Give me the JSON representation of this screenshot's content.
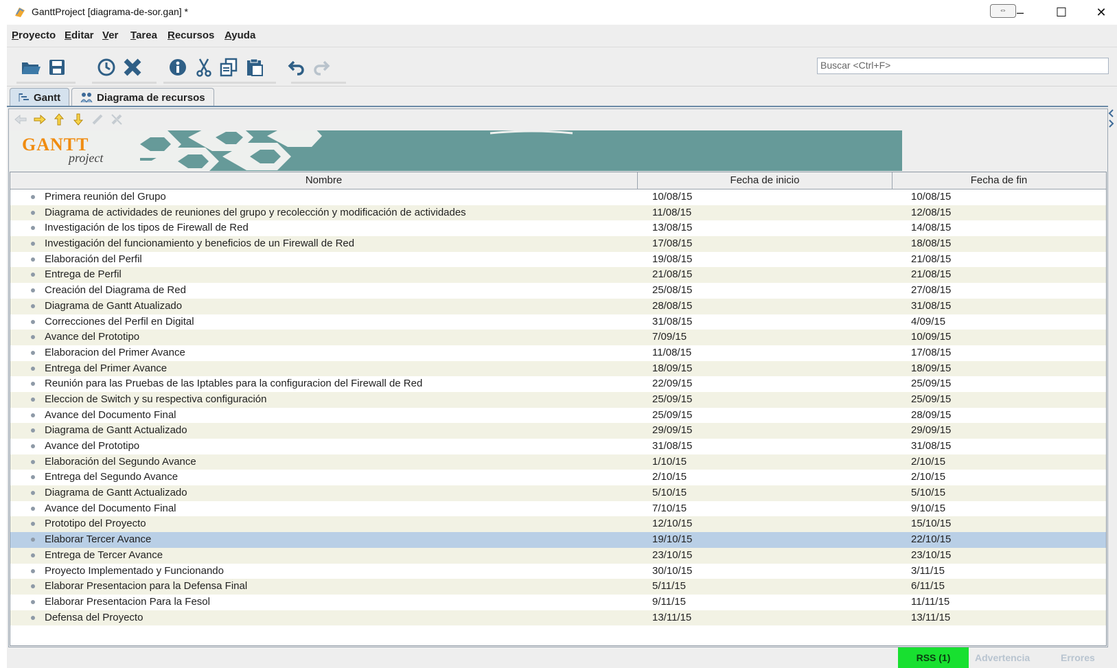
{
  "window": {
    "title": "GanttProject [diagrama-de-sor.gan] *",
    "controls": {
      "minimize": "–",
      "maximize": "☐",
      "close": "✕"
    }
  },
  "menu": [
    {
      "label": "Proyecto",
      "mnemonic": "P",
      "rest": "royecto"
    },
    {
      "label": "Editar",
      "mnemonic": "E",
      "rest": "ditar"
    },
    {
      "label": "Ver",
      "mnemonic": "V",
      "rest": "er"
    },
    {
      "label": "Tarea",
      "mnemonic": "T",
      "rest": "area"
    },
    {
      "label": "Recursos",
      "mnemonic": "R",
      "rest": "ecursos"
    },
    {
      "label": "Ayuda",
      "mnemonic": "A",
      "rest": "yuda"
    }
  ],
  "toolbar": {
    "icons": [
      "open-folder-icon",
      "save-icon",
      "clock-icon",
      "delete-x-icon",
      "info-icon",
      "cut-icon",
      "copy-icon",
      "paste-icon",
      "undo-icon",
      "redo-icon"
    ]
  },
  "search": {
    "placeholder": "Buscar <Ctrl+F>"
  },
  "tabs": [
    {
      "label": "Gantt",
      "active": true
    },
    {
      "label": "Diagrama de recursos",
      "active": false
    }
  ],
  "banner": {
    "logo_main": "GANTT",
    "logo_sub": "project"
  },
  "table": {
    "columns": [
      "Nombre",
      "Fecha de inicio",
      "Fecha de fin"
    ],
    "selected_row": 22,
    "rows": [
      {
        "name": "Primera reunión del Grupo",
        "start": "10/08/15",
        "end": "10/08/15"
      },
      {
        "name": "Diagrama de actividades de reuniones del grupo y recolección y modificación de actividades",
        "start": "11/08/15",
        "end": "12/08/15"
      },
      {
        "name": "Investigación de los tipos de Firewall de Red",
        "start": "13/08/15",
        "end": "14/08/15"
      },
      {
        "name": "Investigación del funcionamiento y beneficios de un Firewall de Red",
        "start": "17/08/15",
        "end": "18/08/15"
      },
      {
        "name": "Elaboración del Perfil",
        "start": "19/08/15",
        "end": "21/08/15"
      },
      {
        "name": "Entrega de Perfil",
        "start": "21/08/15",
        "end": "21/08/15"
      },
      {
        "name": "Creación del Diagrama de Red",
        "start": "25/08/15",
        "end": "27/08/15"
      },
      {
        "name": "Diagrama de Gantt Atualizado",
        "start": "28/08/15",
        "end": "31/08/15"
      },
      {
        "name": "Correcciones del Perfil en Digital",
        "start": "31/08/15",
        "end": "4/09/15"
      },
      {
        "name": "Avance del Prototipo",
        "start": "7/09/15",
        "end": "10/09/15"
      },
      {
        "name": "Elaboracion del Primer Avance",
        "start": "11/08/15",
        "end": "17/08/15"
      },
      {
        "name": "Entrega del Primer Avance",
        "start": "18/09/15",
        "end": "18/09/15"
      },
      {
        "name": "Reunión para las Pruebas de las Iptables para la configuracion del Firewall de Red",
        "start": "22/09/15",
        "end": "25/09/15"
      },
      {
        "name": "Eleccion de Switch y su respectiva configuración",
        "start": "25/09/15",
        "end": "25/09/15"
      },
      {
        "name": "Avance del Documento Final",
        "start": "25/09/15",
        "end": "28/09/15"
      },
      {
        "name": "Diagrama de Gantt Actualizado",
        "start": "29/09/15",
        "end": "29/09/15"
      },
      {
        "name": "Avance del Prototipo",
        "start": "31/08/15",
        "end": "31/08/15"
      },
      {
        "name": "Elaboración del  Segundo Avance",
        "start": "1/10/15",
        "end": "2/10/15"
      },
      {
        "name": "Entrega del Segundo Avance",
        "start": "2/10/15",
        "end": "2/10/15"
      },
      {
        "name": "Diagrama de Gantt Actualizado",
        "start": "5/10/15",
        "end": "5/10/15"
      },
      {
        "name": "Avance del Documento Final",
        "start": "7/10/15",
        "end": "9/10/15"
      },
      {
        "name": "Prototipo del Proyecto",
        "start": "12/10/15",
        "end": "15/10/15"
      },
      {
        "name": "Elaborar Tercer Avance",
        "start": "19/10/15",
        "end": "22/10/15"
      },
      {
        "name": "Entrega de Tercer Avance",
        "start": "23/10/15",
        "end": "23/10/15"
      },
      {
        "name": "Proyecto Implementado y Funcionando",
        "start": "30/10/15",
        "end": "3/11/15"
      },
      {
        "name": "Elaborar Presentacion para la Defensa Final",
        "start": "5/11/15",
        "end": "6/11/15"
      },
      {
        "name": "Elaborar Presentacion Para la Fesol",
        "start": "9/11/15",
        "end": "11/11/15"
      },
      {
        "name": "Defensa del Proyecto",
        "start": "13/11/15",
        "end": "13/11/15"
      }
    ]
  },
  "status": {
    "rss": "RSS (1)",
    "warning": "Advertencia",
    "errors": "Errores"
  },
  "colors": {
    "banner": "#669a99",
    "selected_row": "#b9cfe6",
    "even_row": "#f2f2e4",
    "rss_bg": "#18e030"
  }
}
